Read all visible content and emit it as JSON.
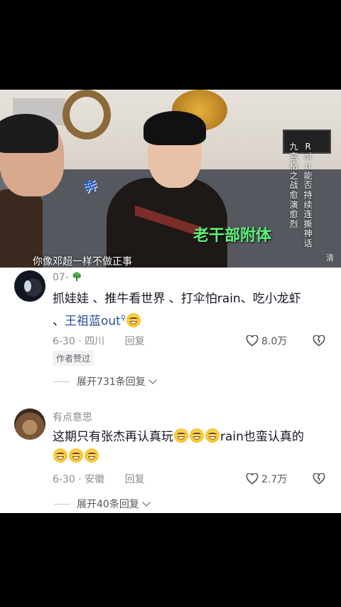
{
  "video": {
    "subtitle": "你像邓超一样不做正事",
    "caption": "老干部附体",
    "vertical_title_1": "九宫格之战愈演愈烈",
    "vertical_title_2": "Rain能否持续连撕神话",
    "watermark": "清",
    "logo": "奔"
  },
  "comments": [
    {
      "username": "07-",
      "text_part1": "抓娃娃 、推牛看世界 、打伞怕rain、吃小龙虾 、",
      "link": "王祖蓝out",
      "date_location": "6-30 · 四川",
      "reply": "回复",
      "likes": "8.0万",
      "badge": "作者赞过",
      "expand": "展开731条回复"
    },
    {
      "username": "有点意思",
      "text_part1": "这期只有张杰再认真玩",
      "text_part2": "rain也蛮认真的",
      "date_location": "6-30 · 安徽",
      "reply": "回复",
      "likes": "2.7万",
      "expand": "展开40条回复"
    }
  ],
  "colors": {
    "link": "#2a4e9c",
    "caption_green": "#5ff07a",
    "meta_gray": "#8a8b91"
  }
}
